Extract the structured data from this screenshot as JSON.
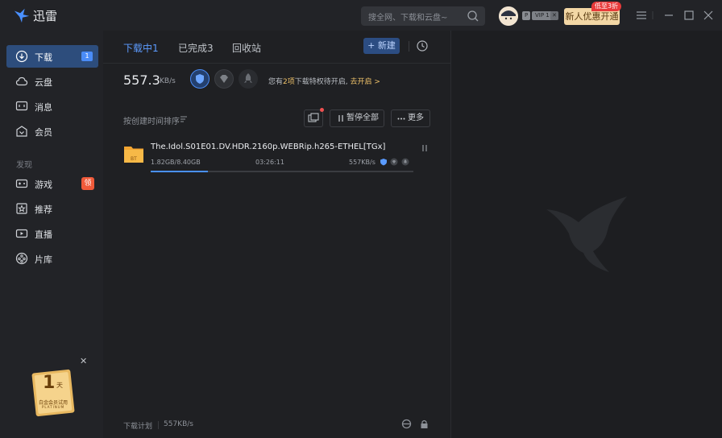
{
  "app": {
    "name": "迅雷"
  },
  "search": {
    "placeholder": "搜全网、下载和云盘~"
  },
  "user": {
    "badge_p": "P",
    "badge_vip": "VIP 1",
    "badge_x": "✕",
    "promo_label": "新人优惠开通",
    "promo_tag": "低至3折"
  },
  "sidebar": {
    "items": [
      {
        "label": "下载",
        "count": "1",
        "icon": "download-icon"
      },
      {
        "label": "云盘",
        "icon": "cloud-icon"
      },
      {
        "label": "消息",
        "icon": "message-icon"
      },
      {
        "label": "会员",
        "icon": "vip-icon"
      }
    ],
    "discover_title": "发现",
    "discover_items": [
      {
        "label": "游戏",
        "badge": "领",
        "icon": "gamepad-icon"
      },
      {
        "label": "推荐",
        "icon": "recommend-icon"
      },
      {
        "label": "直播",
        "icon": "live-icon"
      },
      {
        "label": "片库",
        "icon": "film-icon"
      }
    ],
    "gift_card": {
      "number": "1",
      "unit": "天",
      "caption": "白金会员试用",
      "brand": "PLATINUM"
    }
  },
  "main": {
    "tabs": [
      {
        "label": "下载中1"
      },
      {
        "label": "已完成3"
      },
      {
        "label": "回收站"
      }
    ],
    "new_button": "+ 新建",
    "speed": {
      "value": "557.3",
      "unit": "KB/s"
    },
    "privilege": {
      "prefix": "您有",
      "count": "2项",
      "middle": "下载特权待开启,",
      "action": "去开启 >"
    },
    "sort_label": "按创建时间排序",
    "pause_all": "暂停全部",
    "more": "更多",
    "tasks": [
      {
        "name": "The.Idol.S01E01.DV.HDR.2160p.WEBRip.h265-ETHEL[TGx]",
        "size": "1.82GB/8.40GB",
        "time_left": "03:26:11",
        "speed": "557KB/s",
        "progress": 0.217,
        "file_type": "BT"
      }
    ],
    "footer": {
      "plan_label": "下载计划",
      "speed": "557KB/s"
    }
  },
  "colors": {
    "accent": "#4a90ff",
    "active_nav": "#2d4d7c",
    "gold": "#f0c36a",
    "promo": "#f3d7a5",
    "hot": "#f05a3a"
  }
}
